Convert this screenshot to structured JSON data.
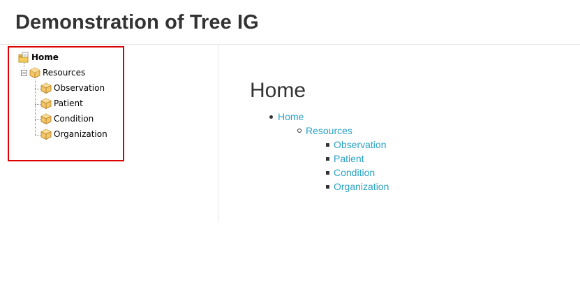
{
  "header": {
    "title": "Demonstration of Tree IG"
  },
  "tree": {
    "root": {
      "label": "Home",
      "icon": "folder-page-icon"
    },
    "group": {
      "label": "Resources",
      "icon": "package-icon",
      "expanded": true
    },
    "items": [
      {
        "label": "Observation",
        "icon": "package-icon"
      },
      {
        "label": "Patient",
        "icon": "package-icon"
      },
      {
        "label": "Condition",
        "icon": "package-icon"
      },
      {
        "label": "Organization",
        "icon": "package-icon"
      }
    ]
  },
  "main": {
    "heading": "Home",
    "nav": {
      "home": "Home",
      "resources": "Resources",
      "items": [
        "Observation",
        "Patient",
        "Condition",
        "Organization"
      ]
    }
  },
  "colors": {
    "link": "#2aa3c6",
    "highlight_border": "#dd0000",
    "divider": "#e5e5e5"
  }
}
